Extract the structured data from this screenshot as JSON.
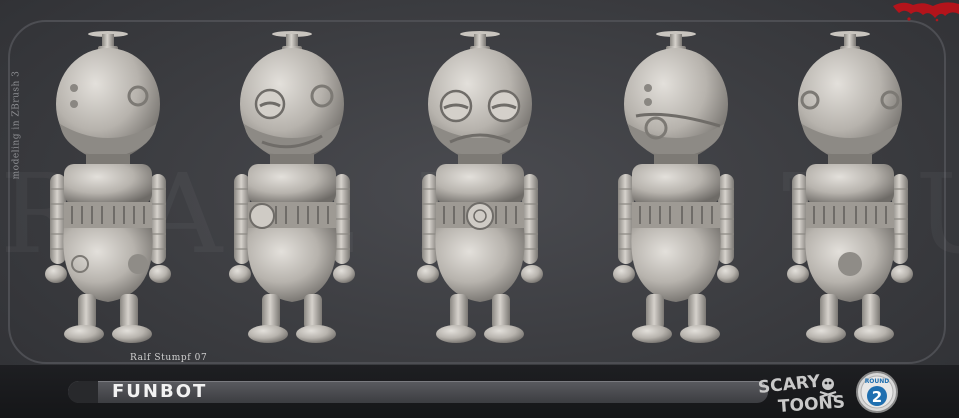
{
  "title": "FUNBOT",
  "artist_credit": "Ralf Stumpf 07",
  "side_caption": "modeling in ZBrush 3",
  "logo": {
    "line1": "SCARY",
    "line2": "TOONS",
    "icon": "skull-crossbones-icon"
  },
  "round_badge": {
    "label": "ROUND",
    "number": "2"
  },
  "colors": {
    "background": "#3a3b3f",
    "clay": "#bdb9b3",
    "bar": "#1a1b1e",
    "splat": "#b3141b"
  }
}
